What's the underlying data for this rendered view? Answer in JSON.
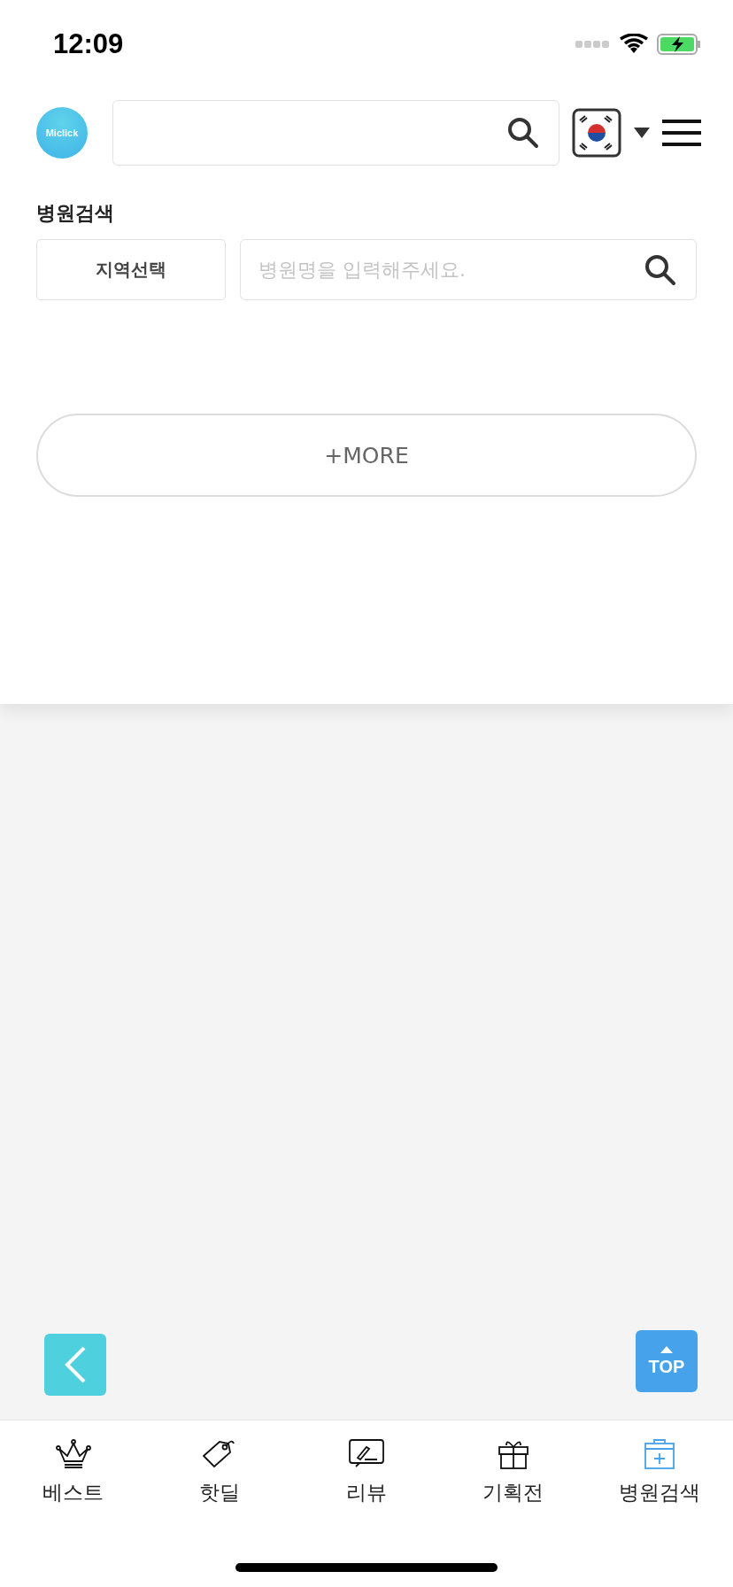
{
  "status_bar": {
    "time": "12:09"
  },
  "header": {
    "logo": "Miclick"
  },
  "hospital_search": {
    "title": "병원검색",
    "region_button": "지역선택",
    "search": {
      "placeholder": "병원명을 입력해주세요."
    }
  },
  "more_button": "+MORE",
  "top_button": "TOP",
  "tab_bar": [
    {
      "label": "베스트",
      "kind": "crown",
      "selected": false
    },
    {
      "label": "핫딜",
      "kind": "tag",
      "selected": false
    },
    {
      "label": "리뷰",
      "kind": "review",
      "selected": false
    },
    {
      "label": "기획전",
      "kind": "gift",
      "selected": false
    },
    {
      "label": "병원검색",
      "kind": "hospital",
      "selected": true
    }
  ]
}
